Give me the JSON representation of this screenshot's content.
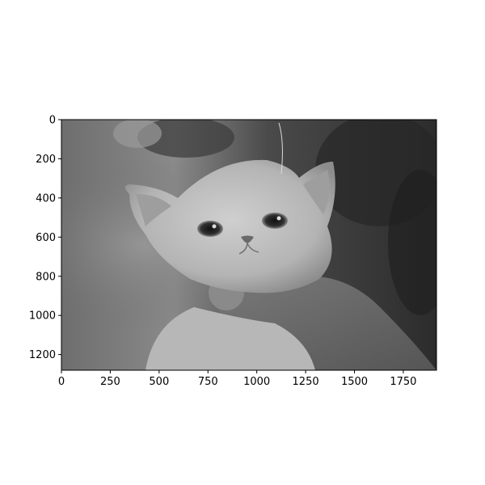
{
  "figure": {
    "background": "#ffffff",
    "image_description_name": "kitten-photo-grayscale",
    "colormap": "gray"
  },
  "axes": {
    "x_ticks": [
      "0",
      "250",
      "500",
      "750",
      "1000",
      "1250",
      "1500",
      "1750"
    ],
    "y_ticks": [
      "0",
      "200",
      "400",
      "600",
      "800",
      "1000",
      "1200"
    ],
    "x_tick_values": [
      0,
      250,
      500,
      750,
      1000,
      1250,
      1500,
      1750
    ],
    "y_tick_values": [
      0,
      200,
      400,
      600,
      800,
      1000,
      1200
    ],
    "x_range": [
      0,
      1920
    ],
    "y_range": [
      1280,
      0
    ]
  }
}
